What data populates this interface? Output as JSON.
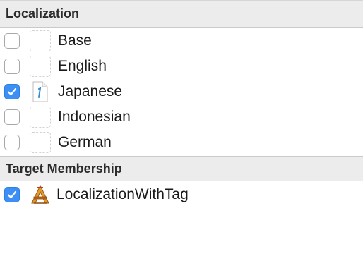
{
  "localization": {
    "header": "Localization",
    "items": [
      {
        "label": "Base",
        "checked": false,
        "has_file": false
      },
      {
        "label": "English",
        "checked": false,
        "has_file": false
      },
      {
        "label": "Japanese",
        "checked": true,
        "has_file": true
      },
      {
        "label": "Indonesian",
        "checked": false,
        "has_file": false
      },
      {
        "label": "German",
        "checked": false,
        "has_file": false
      }
    ]
  },
  "target_membership": {
    "header": "Target Membership",
    "items": [
      {
        "label": "LocalizationWithTag",
        "checked": true,
        "icon": "xcode-app-icon"
      }
    ]
  },
  "colors": {
    "checkbox_checked": "#3b8ff5",
    "header_background": "#ececec"
  }
}
